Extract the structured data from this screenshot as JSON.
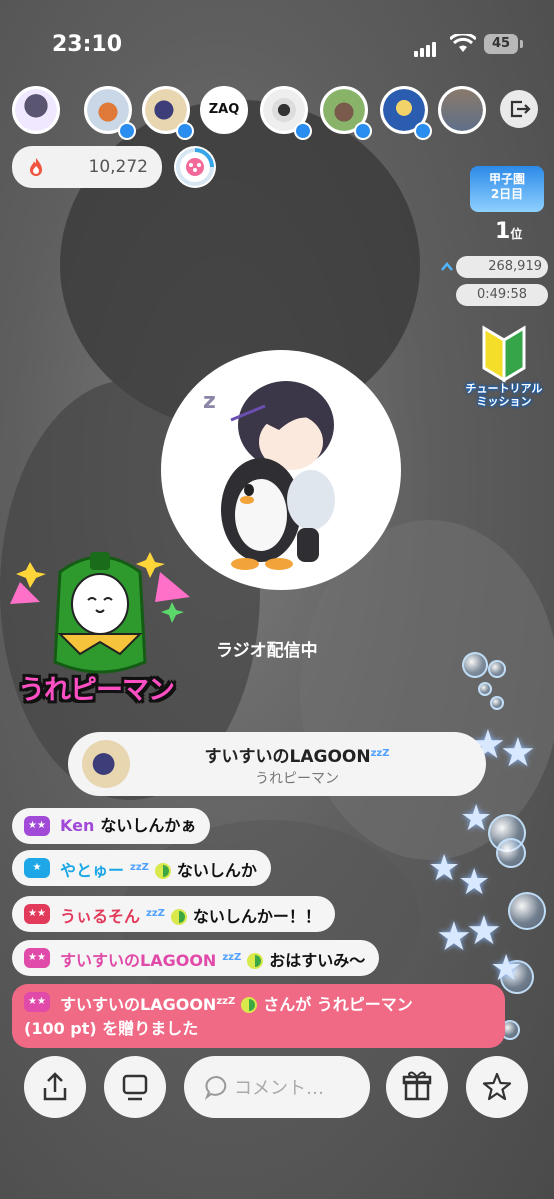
{
  "status_bar": {
    "time": "23:10",
    "battery": "45"
  },
  "score": {
    "value": "10,272"
  },
  "ranking": {
    "event_badge": "甲子園\n2日目",
    "rank": "1",
    "rank_suffix": "位",
    "points": "268,919",
    "timer": "0:49:58"
  },
  "tutorial": {
    "label": "チュートリアル\nミッション"
  },
  "stream": {
    "status_text": "ラジオ配信中"
  },
  "gift_effect": {
    "name": "うれピーマン"
  },
  "gift_banner": {
    "sender": "すいすいのLAGOON",
    "item": "うれピーマン"
  },
  "comments": [
    {
      "user": "Ken",
      "text": "ないしんかぁ",
      "user_color": "#a24ad8",
      "badge_color": "#a24ad8",
      "beginner": false
    },
    {
      "user": "やとゅー",
      "text": "ないしんか",
      "user_color": "#1ea7e6",
      "badge_color": "#1ea7e6",
      "beginner": true
    },
    {
      "user": "うぃるそん",
      "text": "ないしんかー！！",
      "user_color": "#e23a5a",
      "badge_color": "#e23a5a",
      "beginner": true
    },
    {
      "user": "すいすいのLAGOON",
      "text": "おはすいみ～",
      "user_color": "#e04aa8",
      "badge_color": "#e04aa8",
      "beginner": true
    }
  ],
  "zzz": "zzZ",
  "gift_message": {
    "line1_user": "すいすいのLAGOON",
    "line1_rest": "さんが うれピーマン",
    "line2": "(100 pt) を贈りました"
  },
  "input": {
    "placeholder": "コメント…"
  },
  "colors": {
    "gift_bg": "#f06a86",
    "accent_blue": "#2a8df0"
  }
}
